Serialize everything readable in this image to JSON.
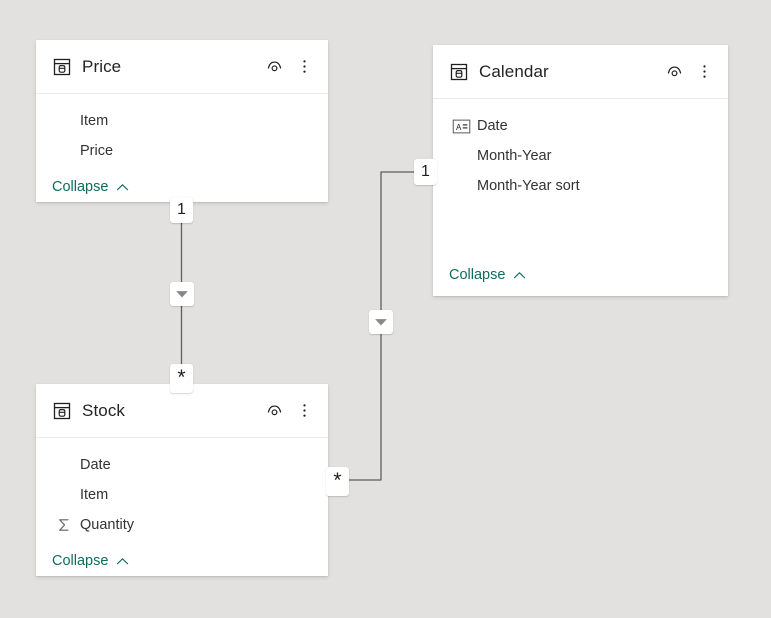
{
  "canvas": {
    "background_color": "#e2e1df",
    "title": "Model relationships diagram"
  },
  "tables": [
    {
      "id": "price",
      "name": "Price",
      "icon": "table-icon",
      "hide_icon": "eye-hide-icon",
      "more_icon": "more-options-icon",
      "collapse_label": "Collapse",
      "collapse_icon": "chevron-up-icon",
      "fields": [
        {
          "label": "Item",
          "icon": "none"
        },
        {
          "label": "Price",
          "icon": "none"
        }
      ]
    },
    {
      "id": "calendar",
      "name": "Calendar",
      "icon": "table-icon",
      "hide_icon": "eye-hide-icon",
      "more_icon": "more-options-icon",
      "collapse_label": "Collapse",
      "collapse_icon": "chevron-up-icon",
      "fields": [
        {
          "label": "Date",
          "icon": "sort-by-column-icon"
        },
        {
          "label": "Month-Year",
          "icon": "none"
        },
        {
          "label": "Month-Year sort",
          "icon": "none"
        }
      ]
    },
    {
      "id": "stock",
      "name": "Stock",
      "icon": "table-icon",
      "hide_icon": "eye-hide-icon",
      "more_icon": "more-options-icon",
      "collapse_label": "Collapse",
      "collapse_icon": "chevron-up-icon",
      "fields": [
        {
          "label": "Date",
          "icon": "none"
        },
        {
          "label": "Item",
          "icon": "none"
        },
        {
          "label": "Quantity",
          "icon": "sigma-aggregate-icon"
        }
      ]
    }
  ],
  "relationships": [
    {
      "id": "price-stock",
      "from_table": "Price",
      "to_table": "Stock",
      "from_cardinality": "1",
      "to_cardinality": "*",
      "direction_icon": "filter-direction-down-icon"
    },
    {
      "id": "calendar-stock",
      "from_table": "Calendar",
      "to_table": "Stock",
      "from_cardinality": "1",
      "to_cardinality": "*",
      "direction_icon": "filter-direction-down-icon"
    }
  ],
  "colors": {
    "background": "#e2e1df",
    "card": "#ffffff",
    "line": "#605e5c",
    "link": "#126b5e",
    "text": "#252423",
    "field_text": "#333333"
  }
}
